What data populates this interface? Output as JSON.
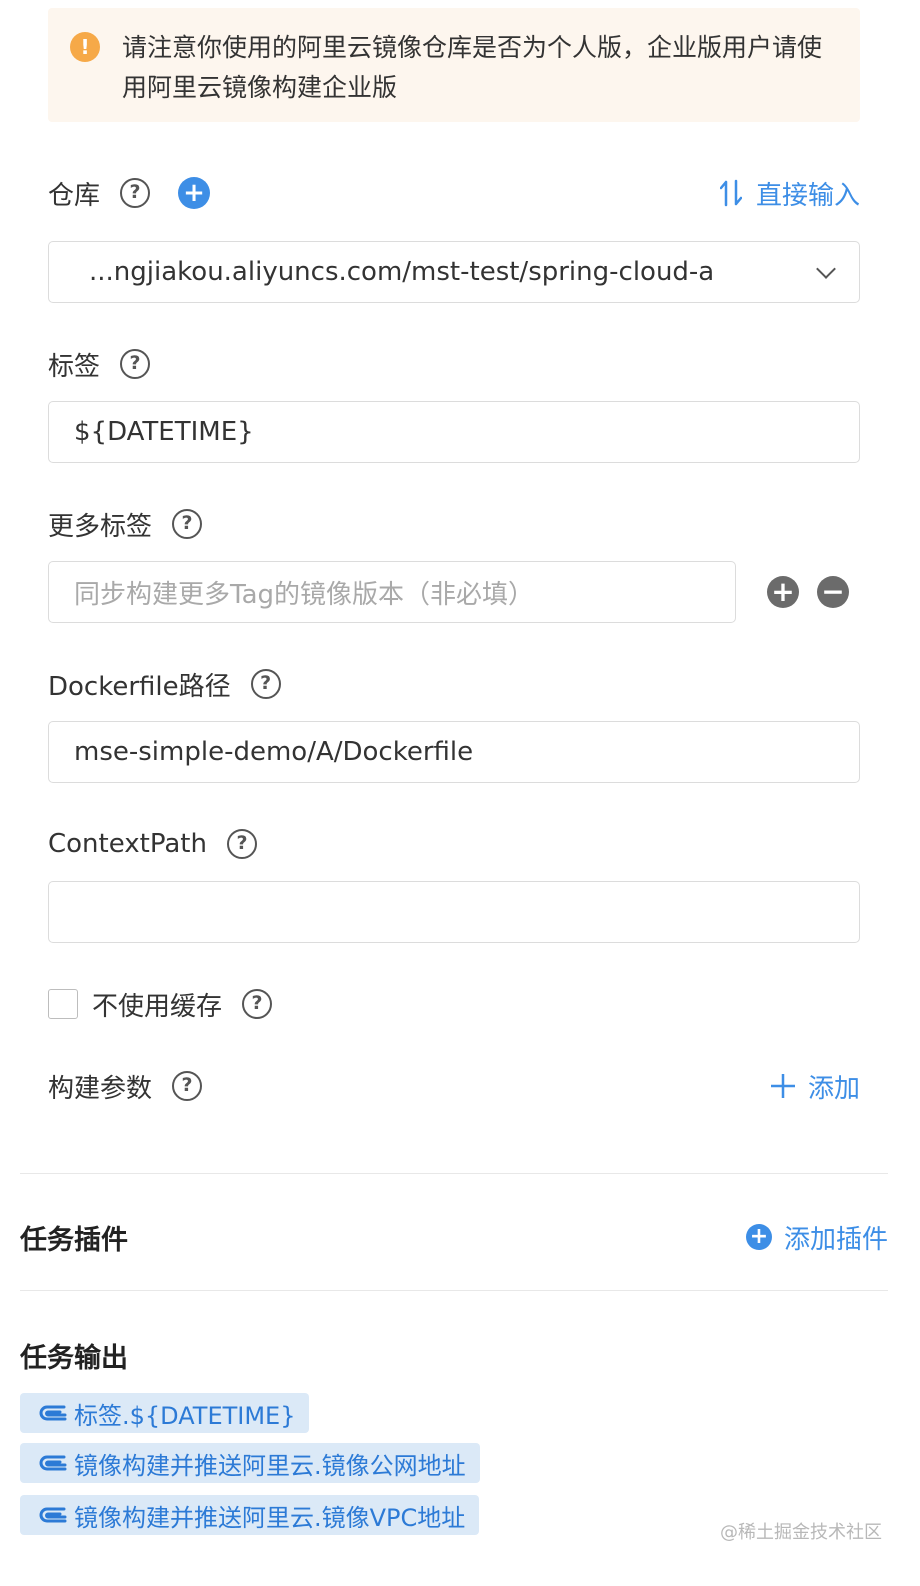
{
  "alert": {
    "icon": "warning-icon",
    "text": "请注意你使用的阿里云镜像仓库是否为个人版，企业版用户请使用阿里云镜像构建企业版"
  },
  "repo": {
    "label": "仓库",
    "direct_input": "直接输入",
    "selected": "...ngjiakou.aliyuncs.com/mst-test/spring-cloud-a"
  },
  "tag": {
    "label": "标签",
    "value": "${DATETIME}"
  },
  "more_tags": {
    "label": "更多标签",
    "placeholder": "同步构建更多Tag的镜像版本（非必填）"
  },
  "dockerfile": {
    "label": "Dockerfile路径",
    "value": "mse-simple-demo/A/Dockerfile"
  },
  "context_path": {
    "label": "ContextPath",
    "value": ""
  },
  "no_cache": {
    "label": "不使用缓存",
    "checked": false
  },
  "build_args": {
    "label": "构建参数",
    "add": "添加"
  },
  "plugins": {
    "title": "任务插件",
    "add": "添加插件"
  },
  "outputs": {
    "title": "任务输出",
    "items": [
      "标签.${DATETIME}",
      "镜像构建并推送阿里云.镜像公网地址",
      "镜像构建并推送阿里云.镜像VPC地址"
    ]
  },
  "watermark": "@稀土掘金技术社区",
  "colors": {
    "accent": "#3d8ee6",
    "warning": "#f6a948",
    "alert_bg": "#fdf6ee",
    "tag_bg": "#dbe9f7"
  }
}
